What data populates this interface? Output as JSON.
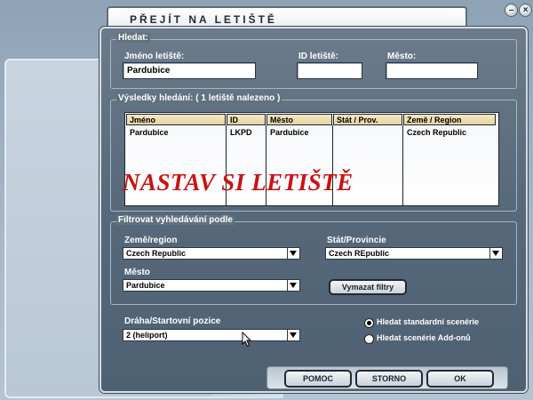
{
  "window": {
    "title": "PŘEJÍT NA LETIŠTĚ",
    "controls": [
      "minimize-icon",
      "close-icon"
    ]
  },
  "search": {
    "title": "Hledat:",
    "airport_name_label": "Jméno letiště:",
    "airport_name_value": "Pardubice",
    "airport_id_label": "ID letiště:",
    "airport_id_value": "",
    "city_label": "Město:",
    "city_value": ""
  },
  "results": {
    "title": "Výsledky hledání: ( 1 letiště nalezeno )",
    "columns": [
      "Jméno",
      "ID",
      "Město",
      "Stát / Prov.",
      "Země / Region"
    ],
    "rows": [
      [
        "Pardubice",
        "LKPD",
        "Pardubice",
        "",
        "Czech Republic"
      ]
    ]
  },
  "overlay": {
    "text": "NASTAV SI LETIŠTĚ",
    "color": "#cc1111"
  },
  "filter": {
    "title": "Filtrovat vyhledávání podle",
    "country_label": "Země/region",
    "country_value": "Czech Republic",
    "state_label": "Stát/Provincie",
    "state_value": "Czech REpublic",
    "city_label": "Město",
    "city_value": "Pardubice",
    "clear_button": "Vymazat filtry"
  },
  "runway": {
    "label": "Dráha/Startovní pozice",
    "value": "2 (heliport)"
  },
  "scenery": {
    "option_standard": "Hledat standardní scenérie",
    "option_addon": "Hledat scenérie Add-onů",
    "selected": "standard"
  },
  "buttons": {
    "help": "POMOC",
    "cancel": "STORNO",
    "ok": "OK"
  }
}
